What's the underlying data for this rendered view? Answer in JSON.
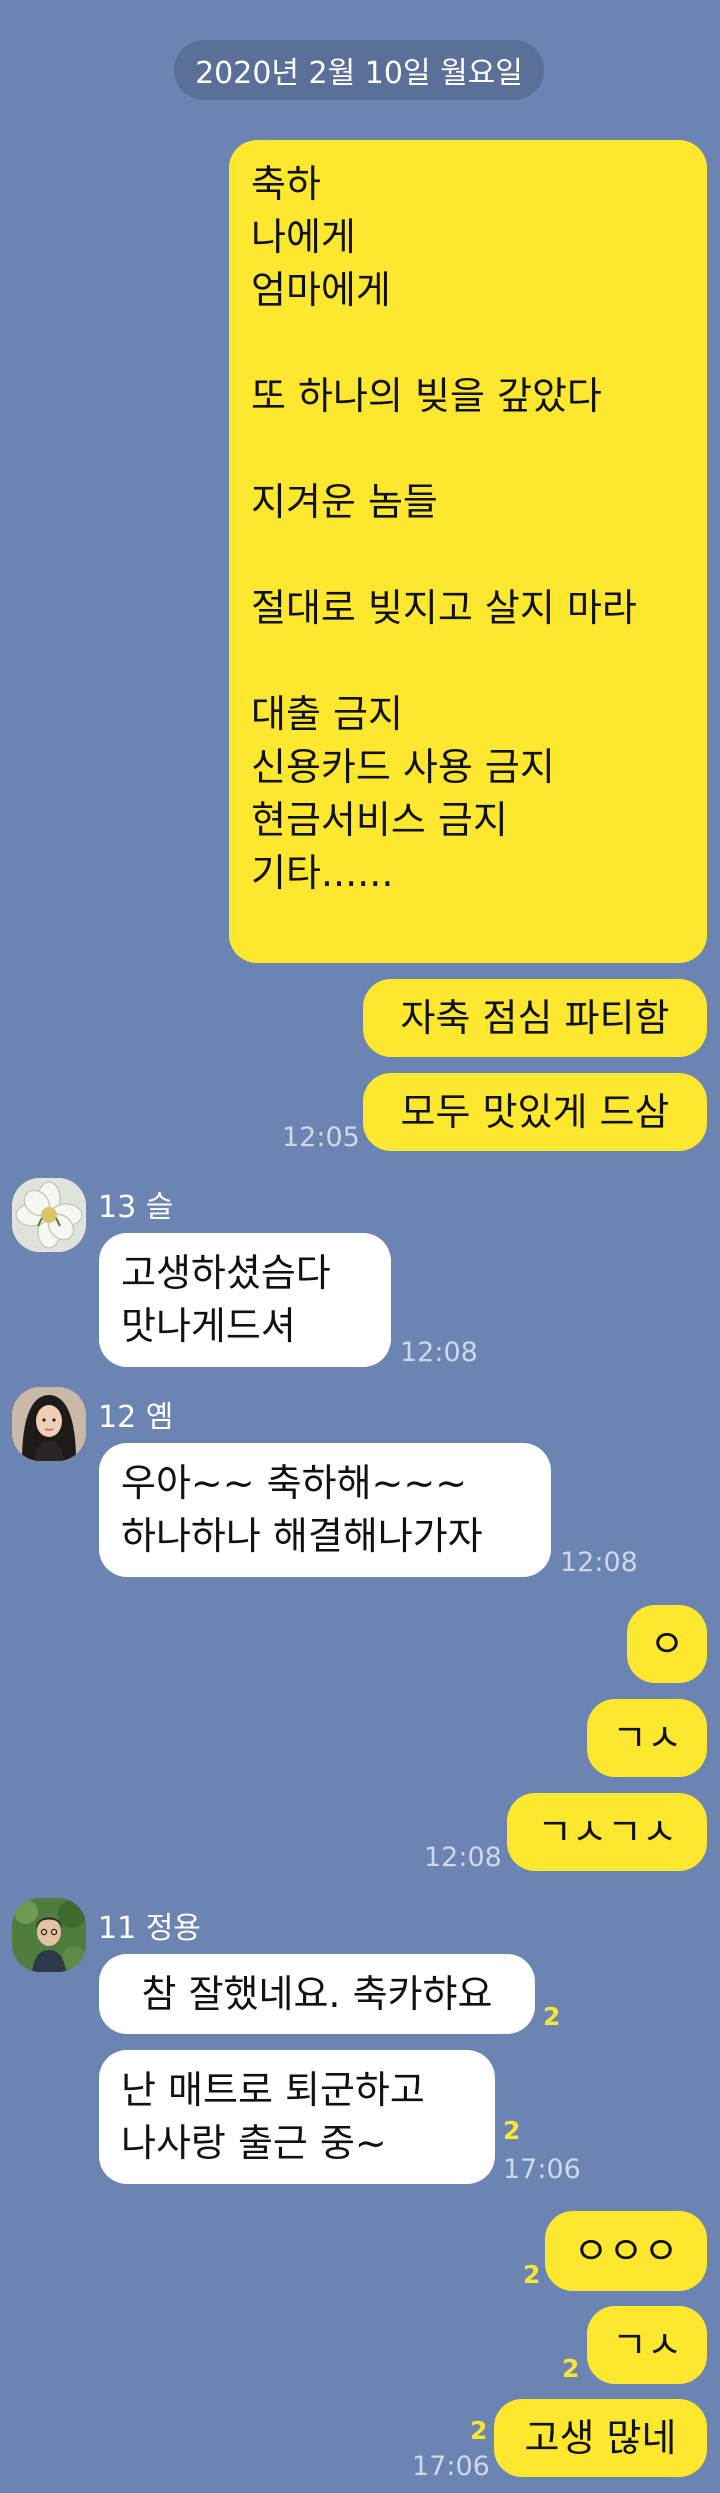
{
  "date_divider": "2020년 2월 10일 월요일",
  "colors": {
    "background": "#6b84b2",
    "my_bubble": "#fde72f",
    "their_bubble": "#ffffff",
    "unread": "#f8e62f"
  },
  "messages": {
    "m1": "축하\n나에게\n엄마에게\n\n또 하나의 빚을 갚았다\n\n지겨운 놈들\n\n절대로 빚지고 살지 마라\n\n대출 금지\n신용카드 사용 금지\n현금서비스 금지\n기타......",
    "m2": "자축 점심 파티함",
    "m3": "모두 맛있게 드삼",
    "m3_time": "12:05",
    "s1_name": "13 슬",
    "m4": "고생하셨슴다\n맛나게드셔",
    "m4_time": "12:08",
    "s2_name": "12 옘",
    "m5": "우아~~ 축하해~~~\n하나하나 해결해나가자",
    "m5_time": "12:08",
    "m6": "ㅇ",
    "m7": "ㄱㅅ",
    "m8": "ㄱㅅㄱㅅ",
    "m8_time": "12:08",
    "s3_name": "11 정용",
    "m9": "참 잘했네요. 축카햐요",
    "m9_unread": "2",
    "m10": "난 매트로 퇴군하고\n나사랑 출근 중~",
    "m10_unread": "2",
    "m10_time": "17:06",
    "m11": "ㅇㅇㅇ",
    "m11_unread": "2",
    "m12": "ㄱㅅ",
    "m12_unread": "2",
    "m13": "고생 많네",
    "m13_unread": "2",
    "m13_time": "17:06"
  }
}
